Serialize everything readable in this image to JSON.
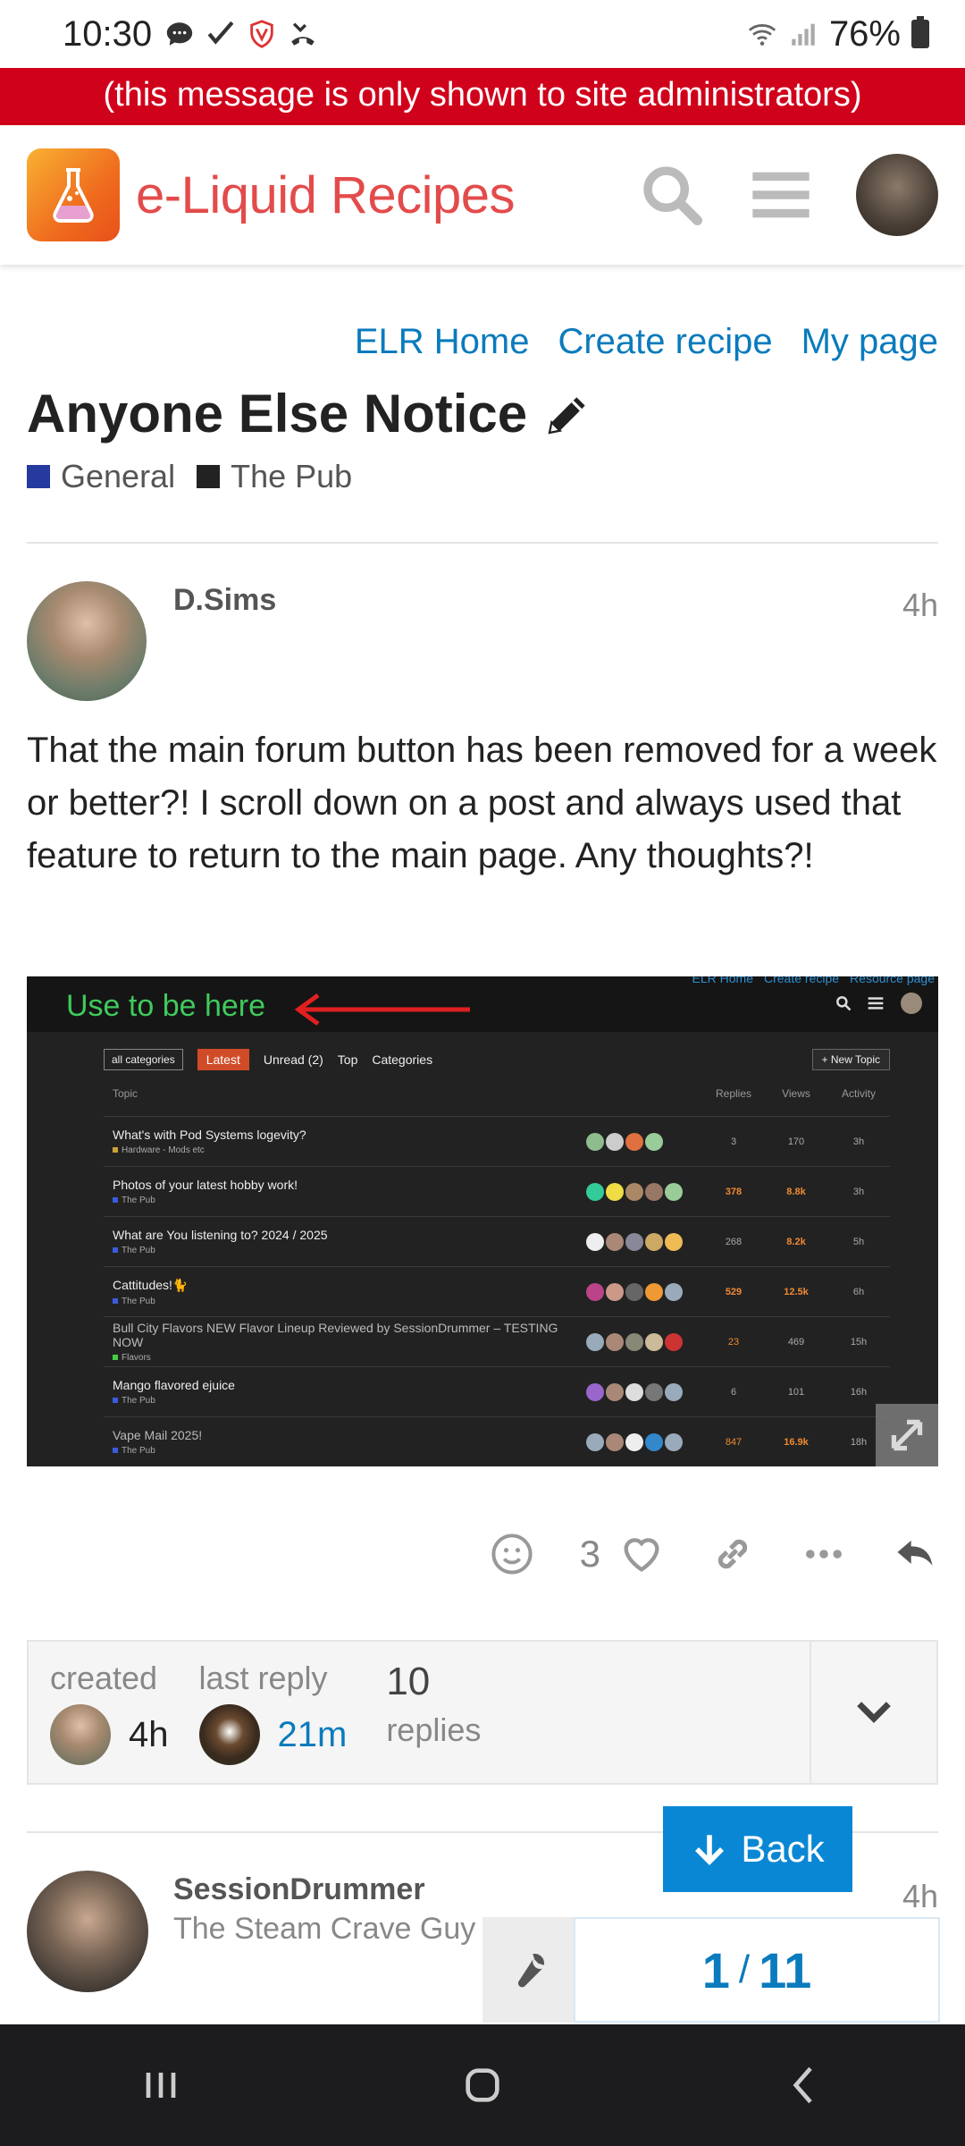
{
  "status_bar": {
    "time": "10:30",
    "battery": "76%"
  },
  "admin_banner": "(this message is only shown to site administrators)",
  "header": {
    "site_name": "e-Liquid Recipes"
  },
  "top_links": [
    "ELR Home",
    "Create recipe",
    "My page"
  ],
  "topic": {
    "title": "Anyone Else Notice",
    "categories": [
      {
        "name": "General",
        "color": "#25399e"
      },
      {
        "name": "The Pub",
        "color": "#222222"
      }
    ]
  },
  "first_post": {
    "author": "D.Sims",
    "time": "4h",
    "body": "That the main forum button has been removed for a week or better?! I scroll down on a post and always used that feature to return to the main page. Any thoughts?!"
  },
  "embedded_screenshot": {
    "annotation": "Use to be here",
    "mini_links": [
      "ELR Home",
      "Create recipe",
      "Resource page"
    ],
    "nav": {
      "all_categories": "all categories",
      "latest": "Latest",
      "unread": "Unread (2)",
      "top": "Top",
      "categories": "Categories",
      "new_topic": "+ New Topic"
    },
    "columns": {
      "topic": "Topic",
      "replies": "Replies",
      "views": "Views",
      "activity": "Activity"
    },
    "rows": [
      {
        "title": "What's with Pod Systems logevity?",
        "category": "Hardware - Mods etc",
        "replies": "3",
        "views": "170",
        "activity": "3h",
        "hot": false
      },
      {
        "title": "Photos of your latest hobby work!",
        "category": "The Pub",
        "replies": "378",
        "views": "8.8k",
        "activity": "3h",
        "hot": true
      },
      {
        "title": "What are You listening to? 2024 / 2025",
        "category": "The Pub",
        "replies": "268",
        "views": "8.2k",
        "activity": "5h",
        "hot": true
      },
      {
        "title": "Cattitudes!🐈",
        "category": "The Pub",
        "replies": "529",
        "views": "12.5k",
        "activity": "6h",
        "hot": true
      },
      {
        "title": "Bull City Flavors NEW Flavor Lineup Reviewed by SessionDrummer – TESTING NOW",
        "category": "Flavors",
        "replies": "23",
        "views": "469",
        "activity": "15h",
        "hot": false
      },
      {
        "title": "Mango flavored ejuice",
        "category": "The Pub",
        "replies": "6",
        "views": "101",
        "activity": "16h",
        "hot": false
      },
      {
        "title": "Vape Mail 2025!",
        "category": "The Pub",
        "replies": "847",
        "views": "16.9k",
        "activity": "18h",
        "hot": true
      }
    ]
  },
  "post_actions": {
    "like_count": "3"
  },
  "topic_map": {
    "created_label": "created",
    "created_time": "4h",
    "last_reply_label": "last reply",
    "last_reply_time": "21m",
    "replies_count": "10",
    "replies_label": "replies"
  },
  "back_button": "Back",
  "second_post": {
    "author": "SessionDrummer",
    "subtitle": "The Steam Crave Guy",
    "time": "4h"
  },
  "progress": {
    "current": "1",
    "total": "11"
  },
  "colors": {
    "accent": "#0a7bbd",
    "admin_red": "#d0021b",
    "brand_text": "#e34b4b"
  }
}
